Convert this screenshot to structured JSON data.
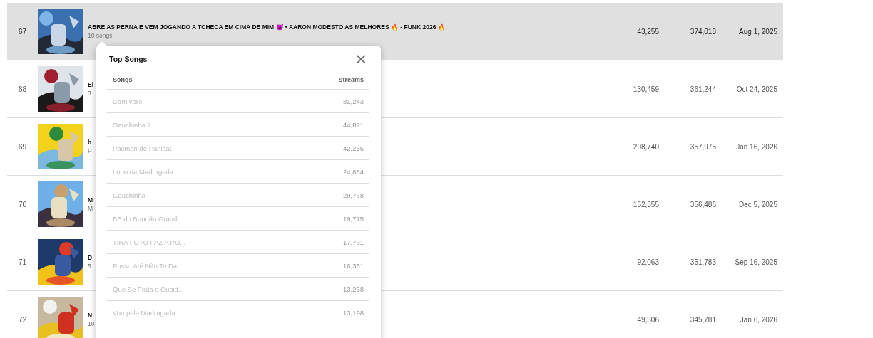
{
  "rows": [
    {
      "rank": "67",
      "title": "ABRE AS PERNA E VEM JOGANDO A TCHECA EM CIMA DE MIM 😈 • AARON MODESTO AS MELHORES 🔥 - FUNK 2026 🔥",
      "subtitle": "10 songs",
      "col_a": "43,255",
      "col_b": "374,018",
      "date": "Aug 1, 2025",
      "selected": true
    },
    {
      "rank": "68",
      "title": "El",
      "subtitle": "3",
      "col_a": "130,459",
      "col_b": "361,244",
      "date": "Oct 24, 2025",
      "selected": false
    },
    {
      "rank": "69",
      "title": "b",
      "subtitle": "P",
      "col_a": "208,740",
      "col_b": "357,975",
      "date": "Jan 16, 2026",
      "selected": false
    },
    {
      "rank": "70",
      "title": "M",
      "subtitle": "M",
      "col_a": "152,355",
      "col_b": "356,486",
      "date": "Dec 5, 2025",
      "selected": false
    },
    {
      "rank": "71",
      "title": "D",
      "subtitle": "5",
      "col_a": "92,063",
      "col_b": "351,783",
      "date": "Sep 16, 2025",
      "selected": false
    },
    {
      "rank": "72",
      "title": "N",
      "subtitle": "10",
      "col_a": "49,306",
      "col_b": "345,781",
      "date": "Jan 6, 2026",
      "selected": false
    }
  ],
  "popup": {
    "title": "Top Songs",
    "close": "×",
    "columns": [
      "Songs",
      "Streams"
    ],
    "songs": [
      {
        "name": "Carnivoro",
        "streams": "81,243"
      },
      {
        "name": "Gauchinha 2",
        "streams": "44,821"
      },
      {
        "name": "Pacman de Panicat",
        "streams": "42,256"
      },
      {
        "name": "Lobo da Madrugada",
        "streams": "24,884"
      },
      {
        "name": "Gauchinha",
        "streams": "20,768"
      },
      {
        "name": "BB do Bundão Grand...",
        "streams": "19,715"
      },
      {
        "name": "TIRA FOTO FAZ A PO...",
        "streams": "17,731"
      },
      {
        "name": "Posso Até Não Te Da...",
        "streams": "16,351"
      },
      {
        "name": "Que Se Foda o Cupid...",
        "streams": "13,258"
      },
      {
        "name": "Vou pela Madrugada",
        "streams": "13,198"
      }
    ]
  }
}
